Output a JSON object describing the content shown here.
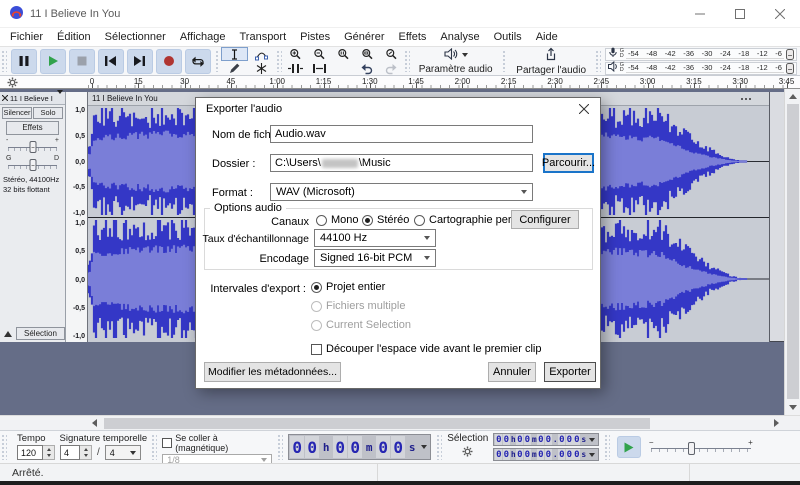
{
  "window": {
    "title": "11 I Believe In You"
  },
  "menu": {
    "items": [
      "Fichier",
      "Édition",
      "Sélectionner",
      "Affichage",
      "Transport",
      "Pistes",
      "Générer",
      "Effets",
      "Analyse",
      "Outils",
      "Aide"
    ]
  },
  "toolbar": {
    "audio_setup_label": "Paramètre audio",
    "share_label": "Partager l'audio",
    "meter_channel_labels": [
      "G",
      "D"
    ],
    "meter_scale": [
      "-54",
      "-48",
      "-42",
      "-36",
      "-30",
      "-24",
      "-18",
      "-12",
      "-6"
    ]
  },
  "timeline": {
    "labels": [
      "0",
      "15",
      "30",
      "45",
      "1:00",
      "1:15",
      "1:30",
      "1:45",
      "2:00",
      "2:15",
      "2:30",
      "2:45",
      "3:00",
      "3:15",
      "3:30",
      "3:45"
    ]
  },
  "track": {
    "header_name": "11 I Believe I",
    "clip_title": "11 I Believe In You",
    "mute_label": "Silencer",
    "solo_label": "Solo",
    "effects_label": "Effets",
    "gain_min_label": "-",
    "gain_max_label": "+",
    "pan_left_label": "G",
    "pan_right_label": "D",
    "info_line1": "Stéréo, 44100Hz",
    "info_line2": "32 bits flottant",
    "select_button_label": "Sélection",
    "amplitude_scale": [
      "1,0",
      "0,5",
      "0,0",
      "-0,5",
      "-1,0"
    ]
  },
  "dialog": {
    "title": "Exporter l'audio",
    "filename_label": "Nom de fichier :",
    "filename_value": "Audio.wav",
    "folder_label": "Dossier :",
    "folder_prefix": "C:\\Users\\",
    "folder_suffix": "\\Music",
    "browse_label": "Parcourir...",
    "format_label": "Format :",
    "format_value": "WAV (Microsoft)",
    "options_group_label": "Options audio",
    "channels_label": "Canaux",
    "channel_options": [
      "Mono",
      "Stéréo",
      "Cartographie personnalisée"
    ],
    "channel_selected": "Stéréo",
    "configure_label": "Configurer",
    "sample_rate_label": "Taux d'échantillonnage",
    "sample_rate_value": "44100 Hz",
    "encoding_label": "Encodage",
    "encoding_value": "Signed 16-bit PCM",
    "export_range_label": "Intervales d'export :",
    "export_range_options": [
      "Projet entier",
      "Fichiers multiple",
      "Current Selection"
    ],
    "export_range_selected": "Projet entier",
    "trim_blank_label": "Découper l'espace vide avant le premier clip",
    "metadata_button_label": "Modifier les métadonnées...",
    "cancel_label": "Annuler",
    "export_label": "Exporter"
  },
  "bottom_toolbar": {
    "tempo_label": "Tempo",
    "tempo_value": "120",
    "time_signature_label": "Signature temporelle",
    "time_signature_upper": "4",
    "time_signature_lower": "4",
    "time_signature_separator": "/",
    "snap_label": "Se coller à (magnétique)",
    "snap_value": "1/8",
    "time_display_value": "00h00m00s",
    "selection_label": "Sélection",
    "selection_start_value": "00h00m00.000s",
    "selection_end_value": "00h00m00.000s"
  },
  "status": {
    "text": "Arrêté."
  }
}
